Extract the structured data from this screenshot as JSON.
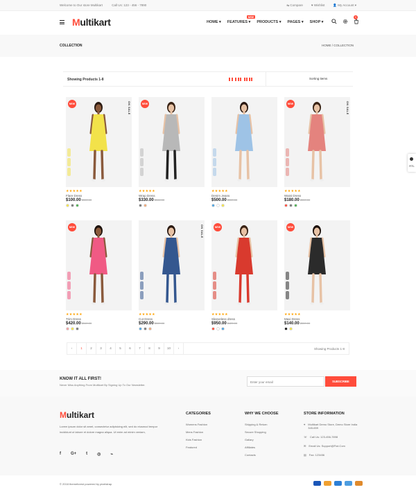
{
  "topbar": {
    "welcome": "Welcome to Our store Multikart",
    "phone": "Call Us: 123 - 456 - 7890",
    "compare": "Compare",
    "wishlist": "Wishlist",
    "account": "My Account"
  },
  "header": {
    "logo_m": "M",
    "logo_rest": "ultikart",
    "nav": [
      "HOME",
      "FEATURES",
      "PRODUCTS",
      "PAGES",
      "SHOP"
    ],
    "new_badge": "NEW",
    "cart_count": "0"
  },
  "breadcrumb": {
    "title": "COLLECTION",
    "path": "HOME  /  COLLECTION"
  },
  "filter": {
    "showing": "Showing Products 1-8",
    "sort": "Sorting items"
  },
  "badges": {
    "new": "NEW",
    "sale": "ON SALE"
  },
  "products": [
    {
      "name": "Flare Dress",
      "price": "$100.00",
      "old": "$300.00",
      "new": true,
      "sale": true,
      "dress": "#f2e24a",
      "skin": "#8a5a3c",
      "hair": "#2b1a12",
      "legs": "#8a5a3c",
      "swatches": [
        "#f2e24a",
        "#777777",
        "#4caf50"
      ]
    },
    {
      "name": "Wrap Dress",
      "price": "$330.00",
      "old": "$344.00",
      "new": true,
      "sale": false,
      "dress": "#b8b8b8",
      "skin": "#e7c2a5",
      "hair": "#3a2416",
      "legs": "#222222",
      "swatches": [
        "#777777",
        "#f0a878"
      ]
    },
    {
      "name": "Denim Jeans",
      "price": "$500.00",
      "old": "$300.00",
      "new": false,
      "sale": false,
      "dress": "#9ec3e6",
      "skin": "#e7c2a5",
      "hair": "#2b1a12",
      "legs": "#e7c2a5",
      "swatches": [
        "#4ea3e0",
        "#ffffff",
        "#f2e24a"
      ]
    },
    {
      "name": "Waist Dress",
      "price": "$180.00",
      "old": "$300.00",
      "new": true,
      "sale": true,
      "dress": "#e4837e",
      "skin": "#e7c2a5",
      "hair": "#3a2416",
      "legs": "#e7c2a5",
      "swatches": [
        "#ff4c3b",
        "#777777",
        "#4caf50"
      ]
    },
    {
      "name": "Trim Dress",
      "price": "$420.00",
      "old": "$340.00",
      "new": true,
      "sale": false,
      "dress": "#f05a84",
      "skin": "#8a5a3c",
      "hair": "#1d120c",
      "legs": "#8a5a3c",
      "swatches": [
        "#f0a0a0",
        "#f2e24a",
        "#777777"
      ]
    },
    {
      "name": "Cut Dress",
      "price": "$290.00",
      "old": "$500.00",
      "new": false,
      "sale": true,
      "dress": "#34578f",
      "skin": "#e7c2a5",
      "hair": "#2b1a12",
      "legs": "#34578f",
      "swatches": [
        "#4ea3e0",
        "#777777",
        "#f0a878"
      ]
    },
    {
      "name": "Sleeveless dress",
      "price": "$950.00",
      "old": "$425.00",
      "new": true,
      "sale": false,
      "dress": "#d93a2e",
      "skin": "#e7c2a5",
      "hair": "#3a2416",
      "legs": "#d93a2e",
      "swatches": [
        "#ff4c3b",
        "#ffffff",
        "#4ea3e0"
      ]
    },
    {
      "name": "Maxi Dress",
      "price": "$140.00",
      "old": "$300.00",
      "new": true,
      "sale": false,
      "dress": "#2b2b2b",
      "skin": "#e7c2a5",
      "hair": "#1d120c",
      "legs": "#e7c2a5",
      "swatches": [
        "#111111",
        "#f2e24a"
      ]
    }
  ],
  "pagination": {
    "prev": "‹",
    "pages": [
      "1",
      "2",
      "3",
      "4",
      "5",
      "6",
      "7",
      "8",
      "9",
      "10"
    ],
    "next": "›",
    "showing": "Showing Products 1-8"
  },
  "newsletter": {
    "title": "KNOW IT ALL FIRST!",
    "subtitle": "Never Miss Anything From Multikart By Signing Up To Our Newsletter.",
    "placeholder": "Enter your email",
    "button": "SUBSCRIBE"
  },
  "footer": {
    "about": "Lorem ipsum dolor sit amet, consectetur adipisicing elit, sed do eiusmod tempor incididunt ut labore et dolore magna aliqua. Ut enim ad minim veniam,",
    "social": [
      "f",
      "G+",
      "t",
      "◎",
      "⌁"
    ],
    "categories": {
      "title": "CATEGORIES",
      "items": [
        "Womens Fashion",
        "Mens Fashion",
        "Kids Fashion",
        "Featured"
      ]
    },
    "why": {
      "title": "WHY WE CHOOSE",
      "items": [
        "Shipping & Return",
        "Secure Shopping",
        "Gallary",
        "Affiliates",
        "Contacts"
      ]
    },
    "store": {
      "title": "STORE INFORMATION",
      "address": "Multikart Demo Store, Demo Store India 345-659",
      "call": "Call Us: 123-456-7898",
      "email": "Email Us: Support@Fiot.Com",
      "fax": "Fax: 123456"
    }
  },
  "bottom": {
    "copyright": "© 2018 themeforest powered by pixelstrap"
  },
  "rtl": "RTL",
  "colors": {
    "accent": "#ff4c3b",
    "star": "#ffa200"
  }
}
